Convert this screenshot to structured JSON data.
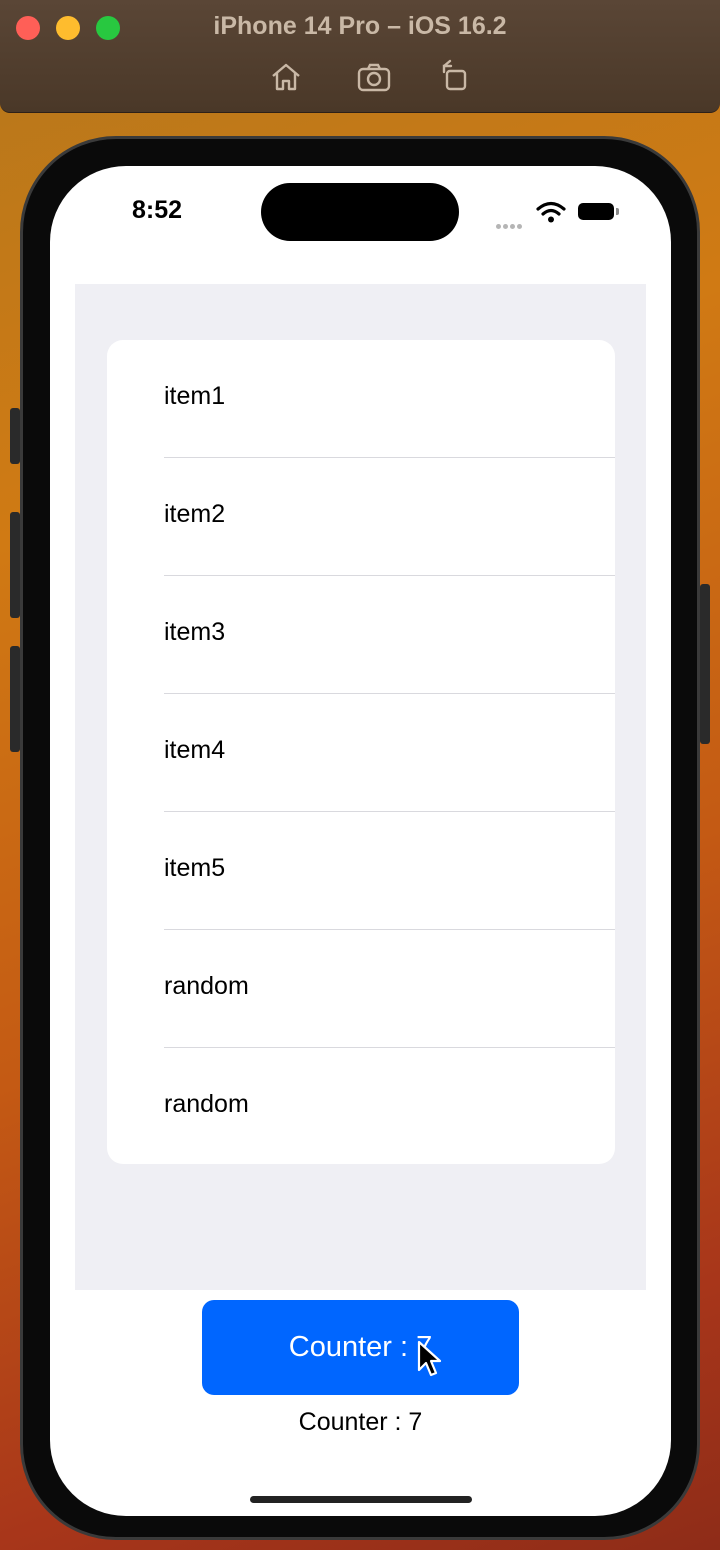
{
  "window": {
    "title": "iPhone 14 Pro – iOS 16.2",
    "toolbar_icons": [
      "home-icon",
      "screenshot-icon",
      "rotate-icon"
    ]
  },
  "status_bar": {
    "time": "8:52",
    "icons": [
      "signal-dots-icon",
      "wifi-icon",
      "battery-icon"
    ]
  },
  "list": {
    "items": [
      {
        "label": "item1"
      },
      {
        "label": "item2"
      },
      {
        "label": "item3"
      },
      {
        "label": "item4"
      },
      {
        "label": "item5"
      },
      {
        "label": "random"
      },
      {
        "label": "random"
      }
    ]
  },
  "counter": {
    "button_label": "Counter : 7",
    "text": "Counter : 7"
  },
  "colors": {
    "accent": "#0066ff",
    "list_background": "#efeff4"
  }
}
